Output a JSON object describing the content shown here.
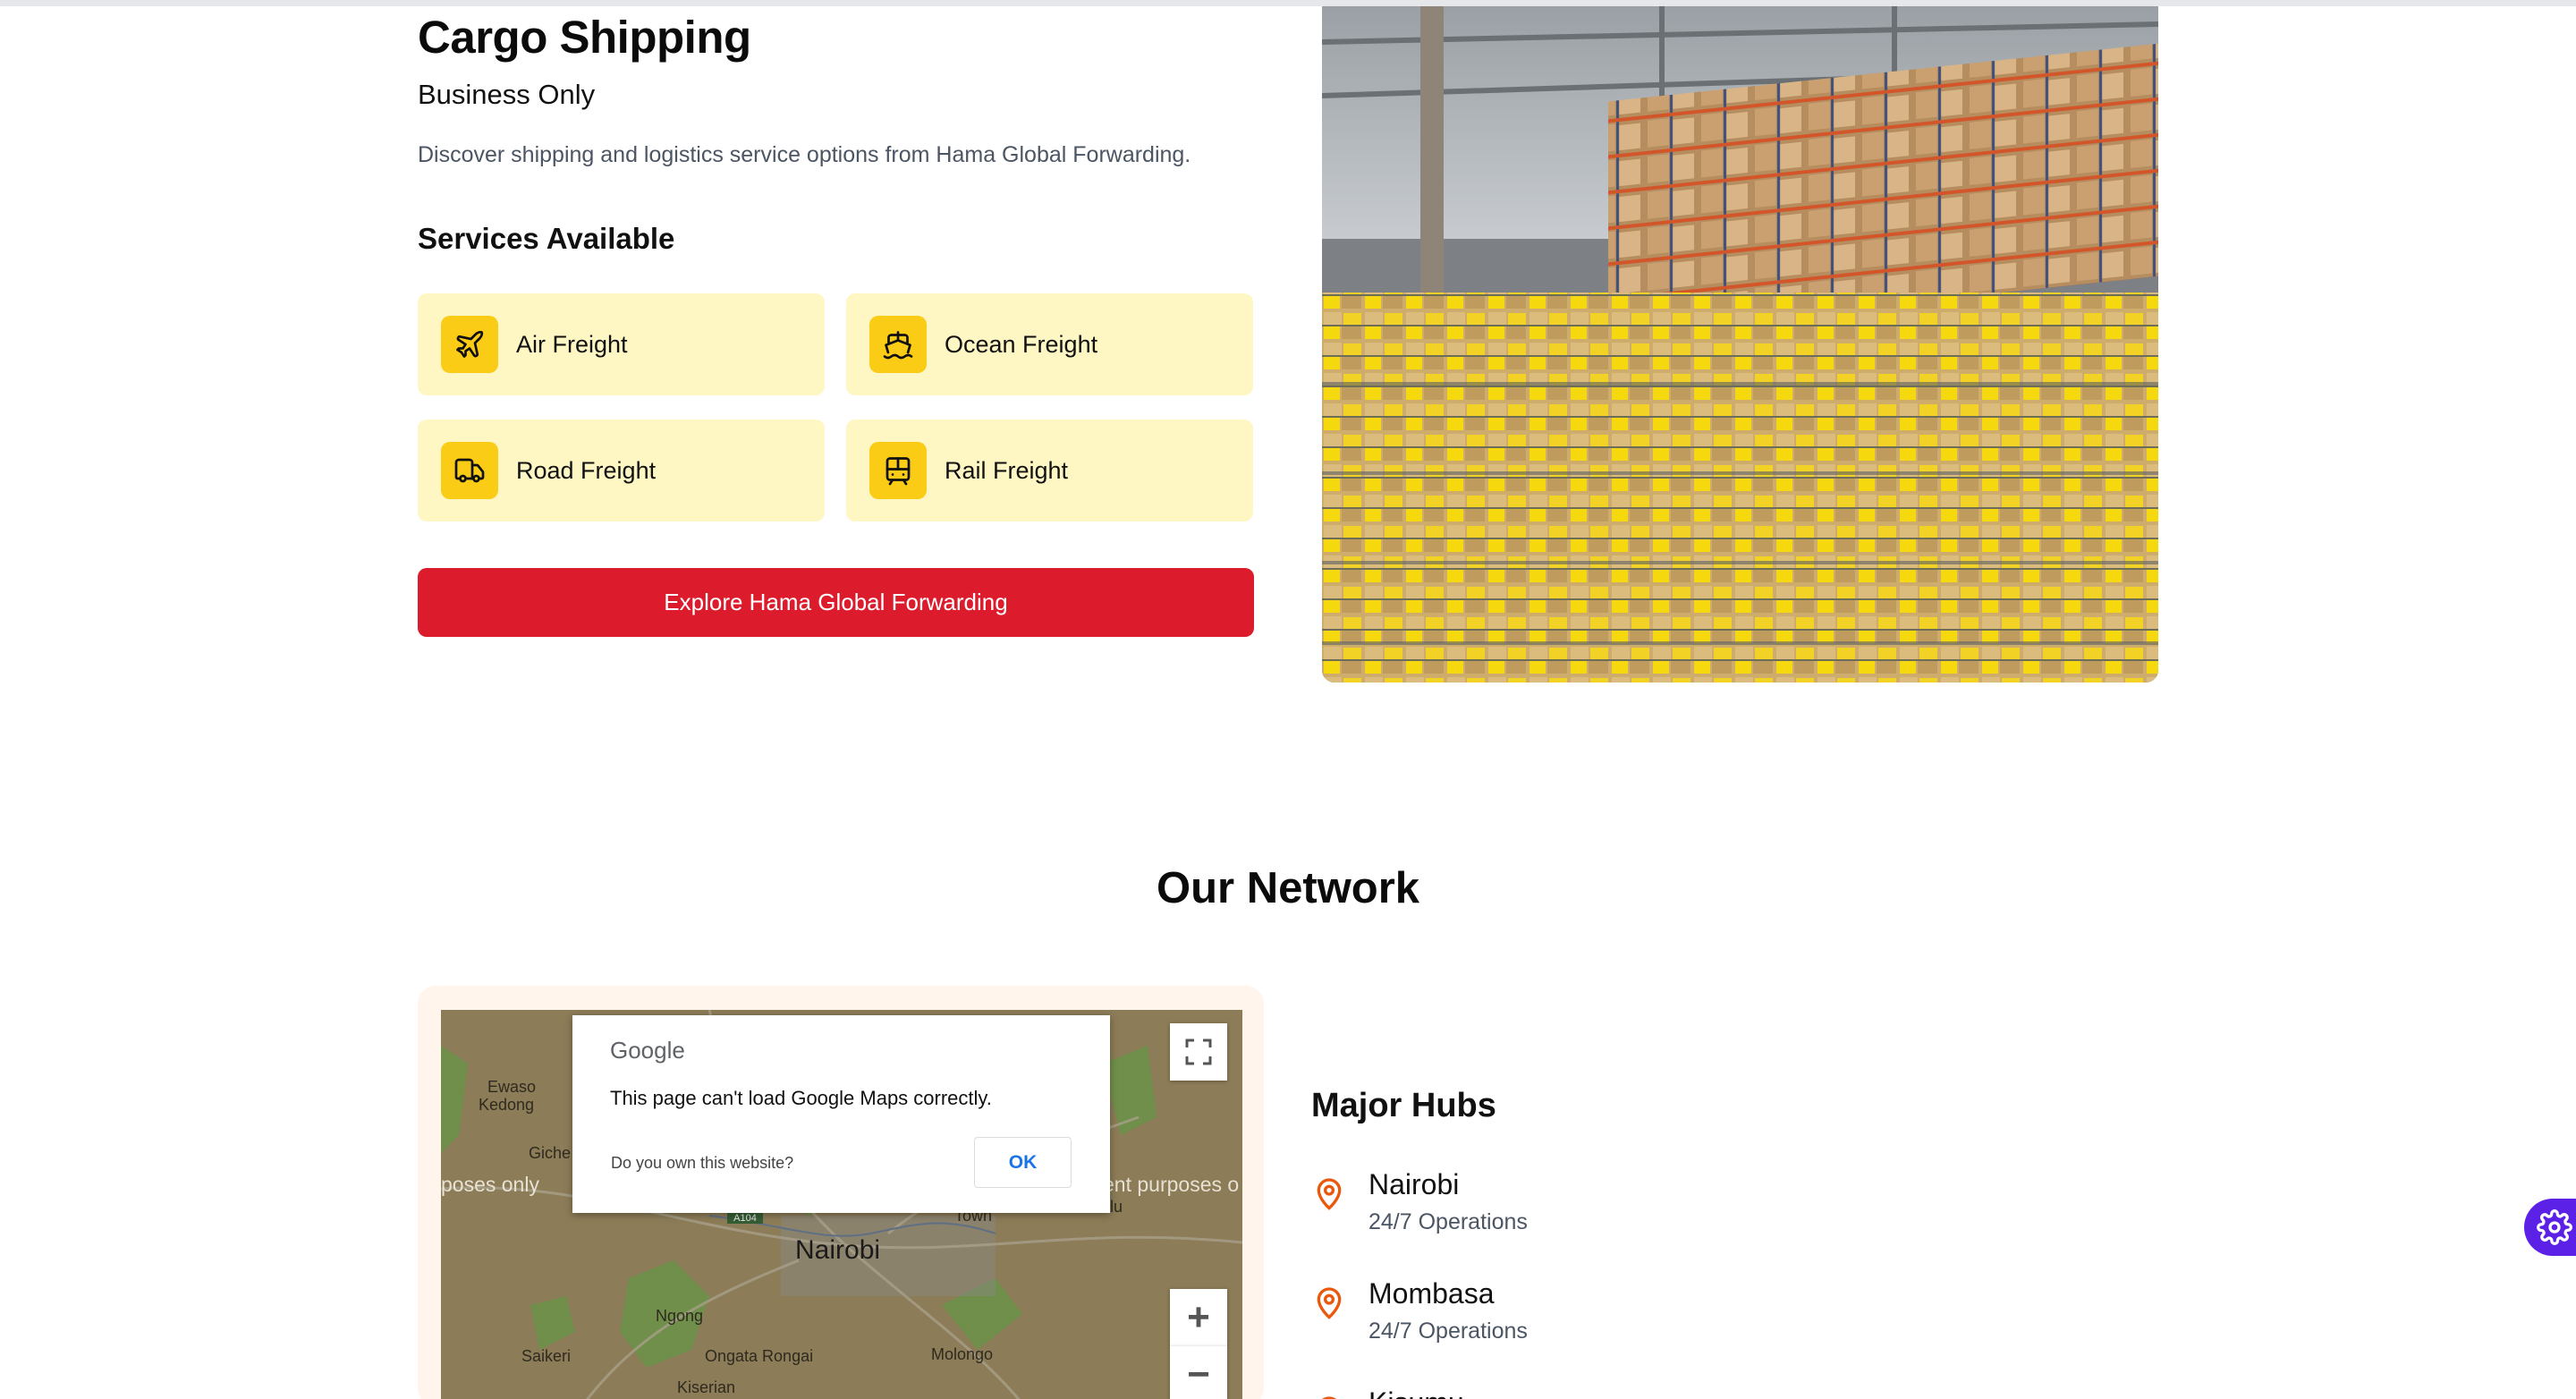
{
  "cargo": {
    "title": "Cargo Shipping",
    "subtitle": "Business Only",
    "description": "Discover shipping and logistics service options from Hama Global Forwarding.",
    "services_title": "Services Available",
    "services": [
      {
        "label": "Air Freight",
        "icon": "plane-icon"
      },
      {
        "label": "Ocean Freight",
        "icon": "ship-icon"
      },
      {
        "label": "Road Freight",
        "icon": "truck-icon"
      },
      {
        "label": "Rail Freight",
        "icon": "train-icon"
      }
    ],
    "cta_label": "Explore Hama Global Forwarding",
    "colors": {
      "card_bg": "#fef7c3",
      "icon_bg": "#facc15",
      "cta_bg": "#dc1b2c"
    }
  },
  "network": {
    "title": "Our Network",
    "map": {
      "labels": {
        "ewaso": "Ewaso",
        "kedong": "Kedong",
        "gichea": "Giche",
        "nairobi": "Nairobi",
        "ngong": "Ngong",
        "saikeri": "Saikeri",
        "ongata": "Ongata Rongai",
        "molongo": "Molongo",
        "kiserian": "Kiserian",
        "town": "Town",
        "ulu": "ulu",
        "road": "A104"
      },
      "watermark_left": "poses only",
      "watermark_right": "ent purposes o",
      "dialog": {
        "logo": "Google",
        "message": "This page can't load Google Maps correctly.",
        "own_question": "Do you own this website?",
        "ok_label": "OK"
      },
      "zoom_in": "+",
      "zoom_out": "−"
    },
    "hubs_title": "Major Hubs",
    "hubs": [
      {
        "name": "Nairobi",
        "status": "24/7 Operations"
      },
      {
        "name": "Mombasa",
        "status": "24/7 Operations"
      },
      {
        "name": "Kisumu",
        "status": ""
      }
    ],
    "accent": "#ea580c"
  }
}
